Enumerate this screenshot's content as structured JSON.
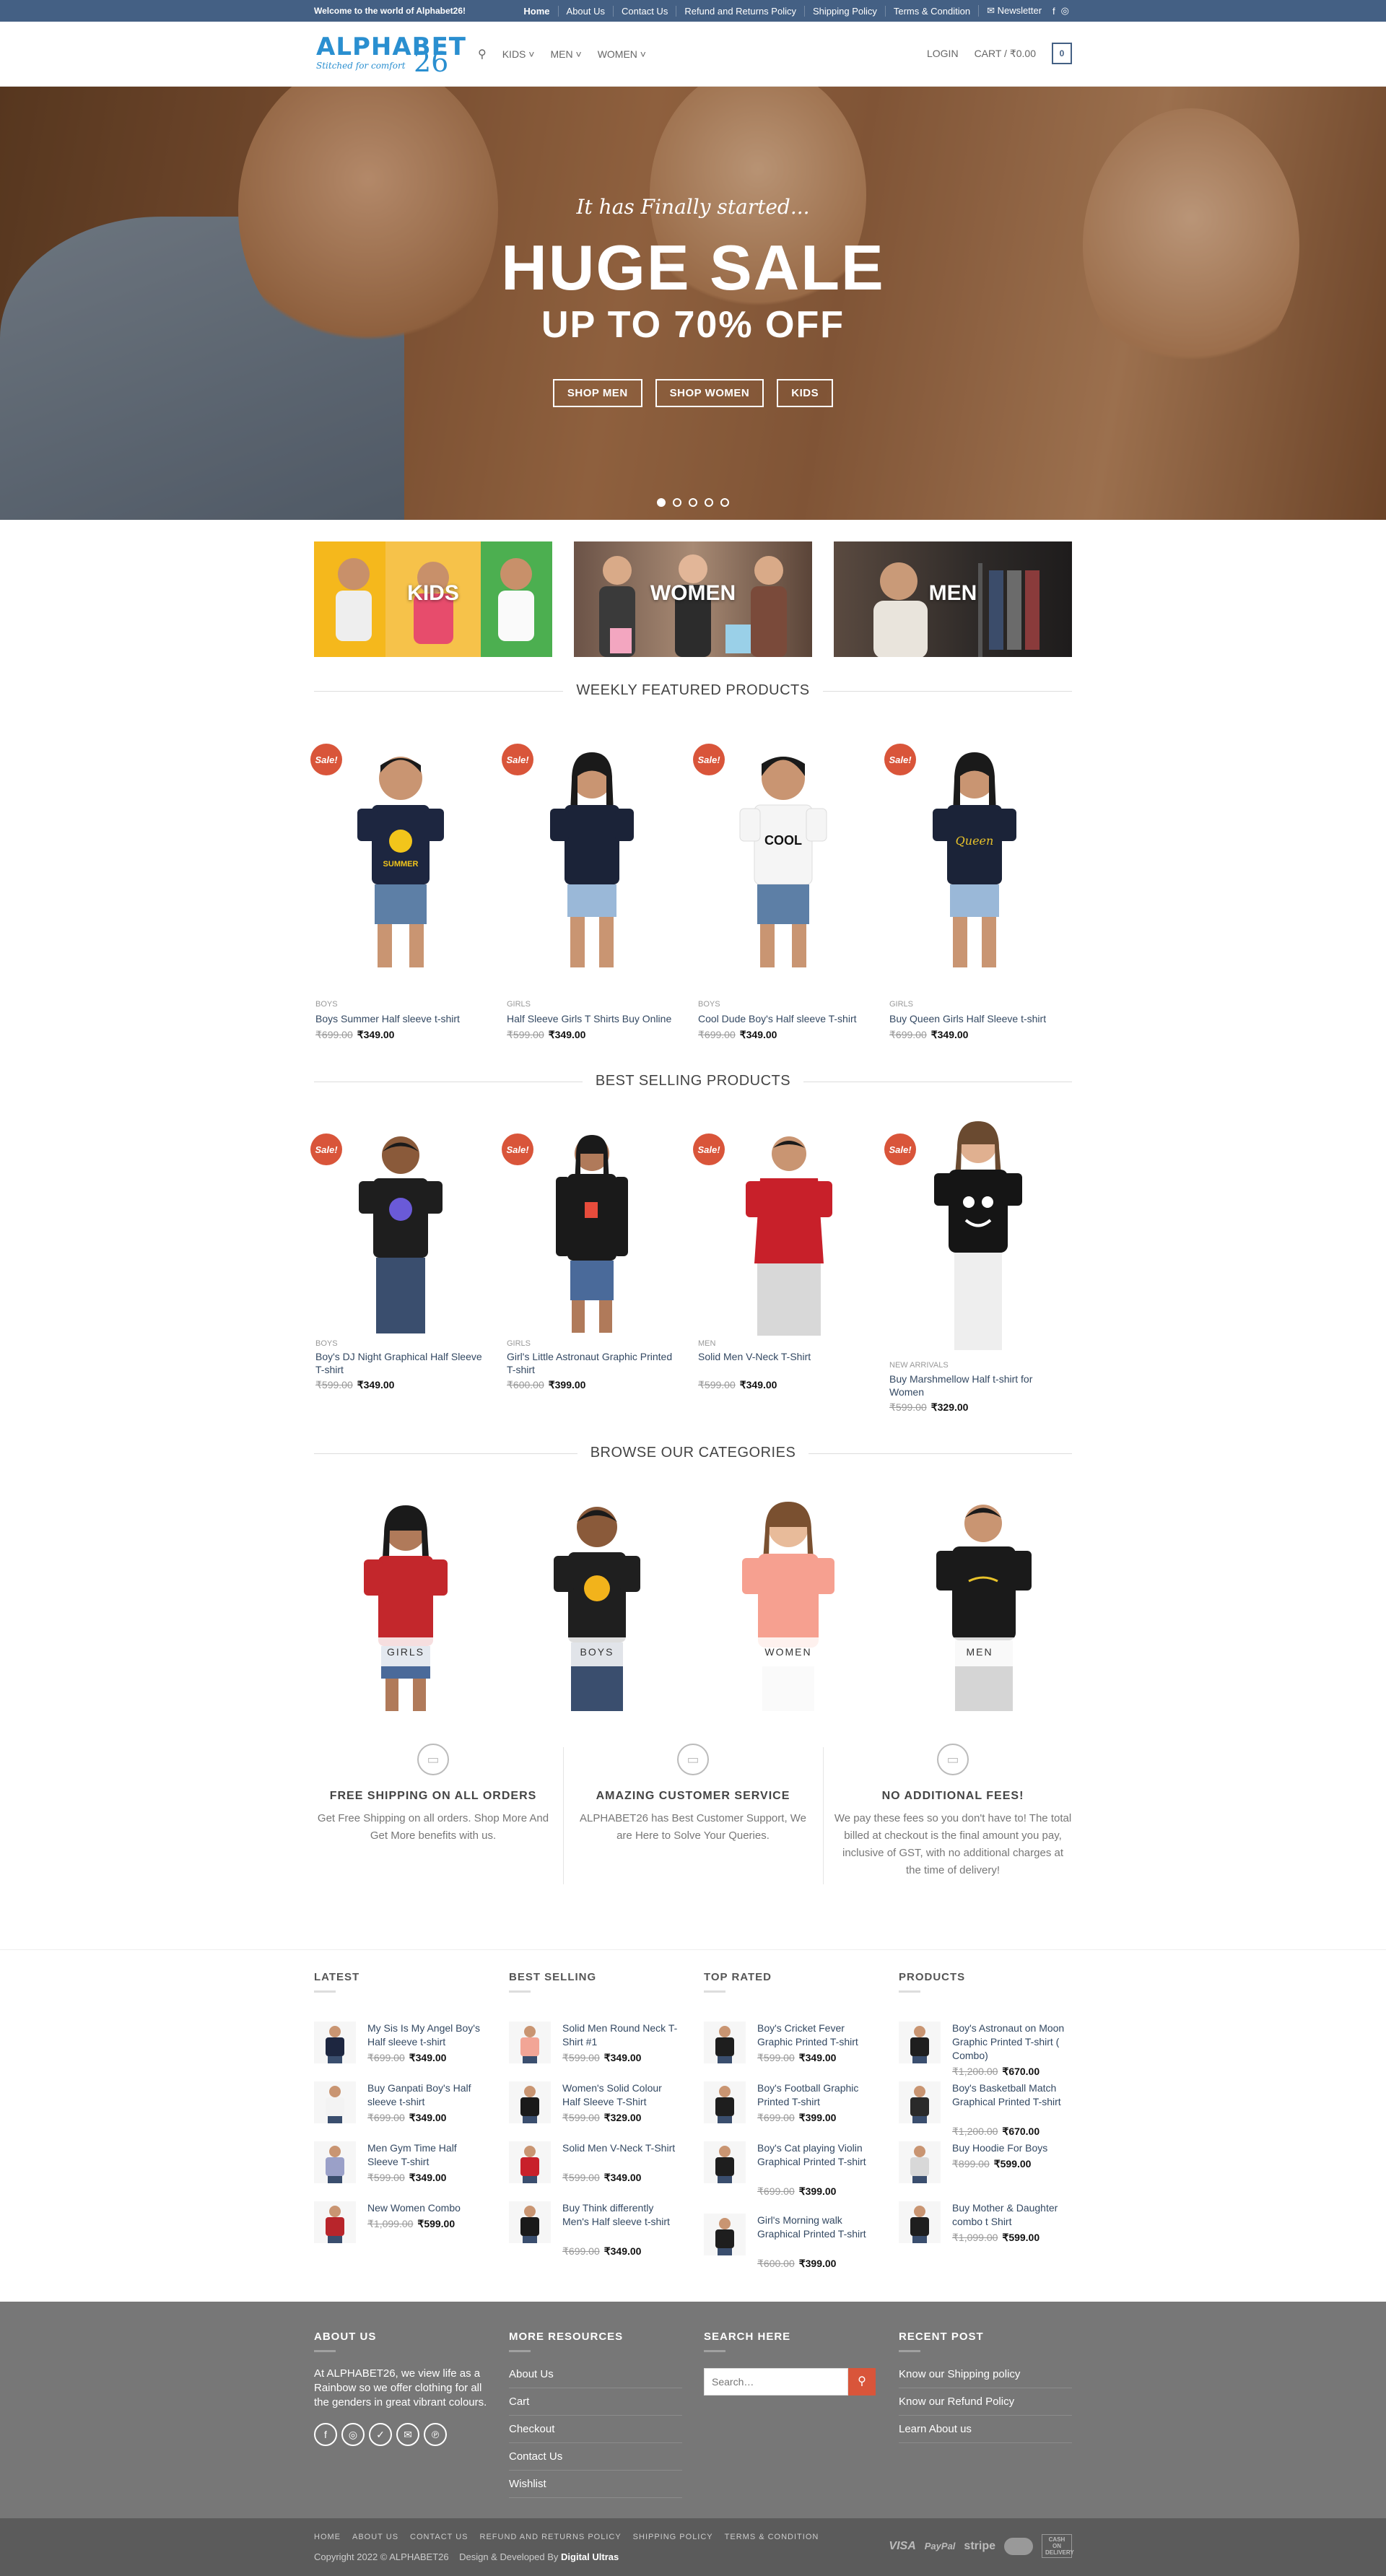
{
  "topbar": {
    "welcome": "Welcome to the world of Alphabet26!",
    "links": [
      "Home",
      "About Us",
      "Contact Us",
      "Refund and Returns Policy",
      "Shipping Policy",
      "Terms & Condition"
    ],
    "newsletter": "Newsletter"
  },
  "header": {
    "logo_text": "ALPHABET",
    "logo_num": "26",
    "logo_tagline": "Stitched for comfort",
    "nav": [
      "KIDS",
      "MEN",
      "WOMEN"
    ],
    "login": "LOGIN",
    "cart": "CART / ₹0.00",
    "cart_count": "0"
  },
  "hero": {
    "kicker": "It has Finally started...",
    "headline": "HUGE SALE",
    "sub": "UP TO 70% OFF",
    "buttons": [
      "SHOP MEN",
      "SHOP WOMEN",
      "KIDS"
    ],
    "slides": 5,
    "active_slide": 1
  },
  "category_banners": [
    "KIDS",
    "WOMEN",
    "MEN"
  ],
  "weekly": {
    "title": "WEEKLY FEATURED PRODUCTS",
    "sale_label": "Sale!",
    "products": [
      {
        "cat": "BOYS",
        "name": "Boys Summer Half sleeve t-shirt",
        "old": "₹699.00",
        "price": "₹349.00",
        "shirt": "#1d2640",
        "print": "SUMMER"
      },
      {
        "cat": "GIRLS",
        "name": "Half Sleeve Girls T Shirts Buy Online",
        "old": "₹599.00",
        "price": "₹349.00",
        "shirt": "#1b2338",
        "print": ""
      },
      {
        "cat": "BOYS",
        "name": "Cool Dude Boy's Half sleeve T-shirt",
        "old": "₹699.00",
        "price": "₹349.00",
        "shirt": "#f5f5f5",
        "print": "COOL"
      },
      {
        "cat": "GIRLS",
        "name": "Buy Queen Girls Half Sleeve t-shirt",
        "old": "₹699.00",
        "price": "₹349.00",
        "shirt": "#1b2338",
        "print": "Queen"
      }
    ]
  },
  "bestselling": {
    "title": "BEST SELLING PRODUCTS",
    "products": [
      {
        "cat": "BOYS",
        "name": "Boy's DJ Night Graphical Half Sleeve T-shirt",
        "old": "₹599.00",
        "price": "₹349.00",
        "shirt": "#1e1e1e",
        "sale": true
      },
      {
        "cat": "GIRLS",
        "name": "Girl's Little Astronaut Graphic Printed T-shirt",
        "old": "₹600.00",
        "price": "₹399.00",
        "shirt": "#1a1a1a",
        "sale": true
      },
      {
        "cat": "MEN",
        "name": "Solid Men V-Neck T-Shirt",
        "old": "₹599.00",
        "price": "₹349.00",
        "shirt": "#c8202a",
        "sale": true
      },
      {
        "cat": "NEW ARRIVALS",
        "name": "Buy Marshmellow Half t-shirt for Women",
        "old": "₹599.00",
        "price": "₹329.00",
        "shirt": "#151515",
        "sale": true
      }
    ]
  },
  "browse": {
    "title": "BROWSE OUR CATEGORIES",
    "items": [
      {
        "label": "GIRLS",
        "shirt": "#c3272c"
      },
      {
        "label": "BOYS",
        "shirt": "#1f1f1f"
      },
      {
        "label": "WOMEN",
        "shirt": "#f6a090"
      },
      {
        "label": "MEN",
        "shirt": "#1a1a1a"
      }
    ]
  },
  "features": [
    {
      "title": "FREE SHIPPING ON ALL ORDERS",
      "text": "Get Free Shipping on all orders. Shop More And Get More benefits with us."
    },
    {
      "title": "AMAZING CUSTOMER SERVICE",
      "text": "ALPHABET26 has Best Customer Support, We are Here to Solve Your Queries."
    },
    {
      "title": "NO ADDITIONAL FEES!",
      "text": "We pay these fees so you don't have to! The total billed at checkout is the final amount you pay, inclusive of GST, with no additional charges at the time of delivery!"
    }
  ],
  "widgets": [
    {
      "title": "LATEST",
      "items": [
        {
          "name": "My Sis Is My Angel Boy's Half sleeve t-shirt",
          "old": "₹699.00",
          "price": "₹349.00",
          "color": "#1d2640"
        },
        {
          "name": "Buy Ganpati Boy's Half sleeve t-shirt",
          "old": "₹699.00",
          "price": "₹349.00",
          "color": "#f3f3f3"
        },
        {
          "name": "Men Gym Time Half Sleeve T-shirt",
          "old": "₹599.00",
          "price": "₹349.00",
          "color": "#9aa0c8"
        },
        {
          "name": "New Women Combo",
          "old": "₹1,099.00",
          "price": "₹599.00",
          "color": "#b8252b"
        }
      ]
    },
    {
      "title": "BEST SELLING",
      "items": [
        {
          "name": "Solid Men Round Neck T-Shirt #1",
          "old": "₹599.00",
          "price": "₹349.00",
          "color": "#f2a596"
        },
        {
          "name": "Women's Solid Colour Half Sleeve T-Shirt",
          "old": "₹599.00",
          "price": "₹329.00",
          "color": "#1a1a1a"
        },
        {
          "name": "Solid Men V-Neck T-Shirt",
          "old": "₹599.00",
          "price": "₹349.00",
          "color": "#c8202a"
        },
        {
          "name": "Buy Think differently Men's Half sleeve t-shirt",
          "old": "₹699.00",
          "price": "₹349.00",
          "color": "#1a1a1a"
        }
      ]
    },
    {
      "title": "TOP RATED",
      "items": [
        {
          "name": "Boy's Cricket Fever Graphic Printed T-shirt",
          "old": "₹599.00",
          "price": "₹349.00",
          "color": "#1e1e1e"
        },
        {
          "name": "Boy's Football Graphic Printed T-shirt",
          "old": "₹699.00",
          "price": "₹399.00",
          "color": "#1e1e1e"
        },
        {
          "name": "Boy's Cat playing Violin Graphical Printed T-shirt",
          "old": "₹699.00",
          "price": "₹399.00",
          "color": "#1e1e1e"
        },
        {
          "name": "Girl's Morning walk Graphical Printed T-shirt",
          "old": "₹600.00",
          "price": "₹399.00",
          "color": "#1e1e1e"
        }
      ]
    },
    {
      "title": "PRODUCTS",
      "items": [
        {
          "name": "Boy's Astronaut on Moon Graphic Printed T-shirt ( Combo)",
          "old": "₹1,200.00",
          "price": "₹670.00",
          "color": "#1e1e1e"
        },
        {
          "name": "Boy's Basketball Match Graphical Printed T-shirt",
          "old": "₹1,200.00",
          "price": "₹670.00",
          "color": "#2a2a2a"
        },
        {
          "name": "Buy Hoodie For Boys",
          "old": "₹899.00",
          "price": "₹599.00",
          "color": "#d8d8d8"
        },
        {
          "name": "Buy Mother & Daughter combo t Shirt",
          "old": "₹1,099.00",
          "price": "₹599.00",
          "color": "#1e1e1e"
        }
      ]
    }
  ],
  "footer": {
    "about_title": "ABOUT US",
    "about_text": "At ALPHABET26, we view life as a Rainbow so we offer clothing for all the genders in great vibrant colours.",
    "resources_title": "MORE RESOURCES",
    "resources": [
      "About Us",
      "Cart",
      "Checkout",
      "Contact Us",
      "Wishlist"
    ],
    "search_title": "SEARCH HERE",
    "search_placeholder": "Search…",
    "recent_title": "RECENT POST",
    "recent": [
      "Know our Shipping policy",
      "Know our Refund Policy",
      "Learn About us"
    ],
    "bottom_links": [
      "HOME",
      "ABOUT US",
      "CONTACT US",
      "REFUND AND RETURNS POLICY",
      "SHIPPING POLICY",
      "TERMS & CONDITION"
    ],
    "copyright": "Copyright 2022 © ALPHABET26",
    "credit_pre": "Design & Developed By",
    "credit": "Digital Ultras",
    "payments": [
      "VISA",
      "PayPal",
      "stripe",
      "mastercard",
      "CASH ON DELIVERY"
    ]
  }
}
